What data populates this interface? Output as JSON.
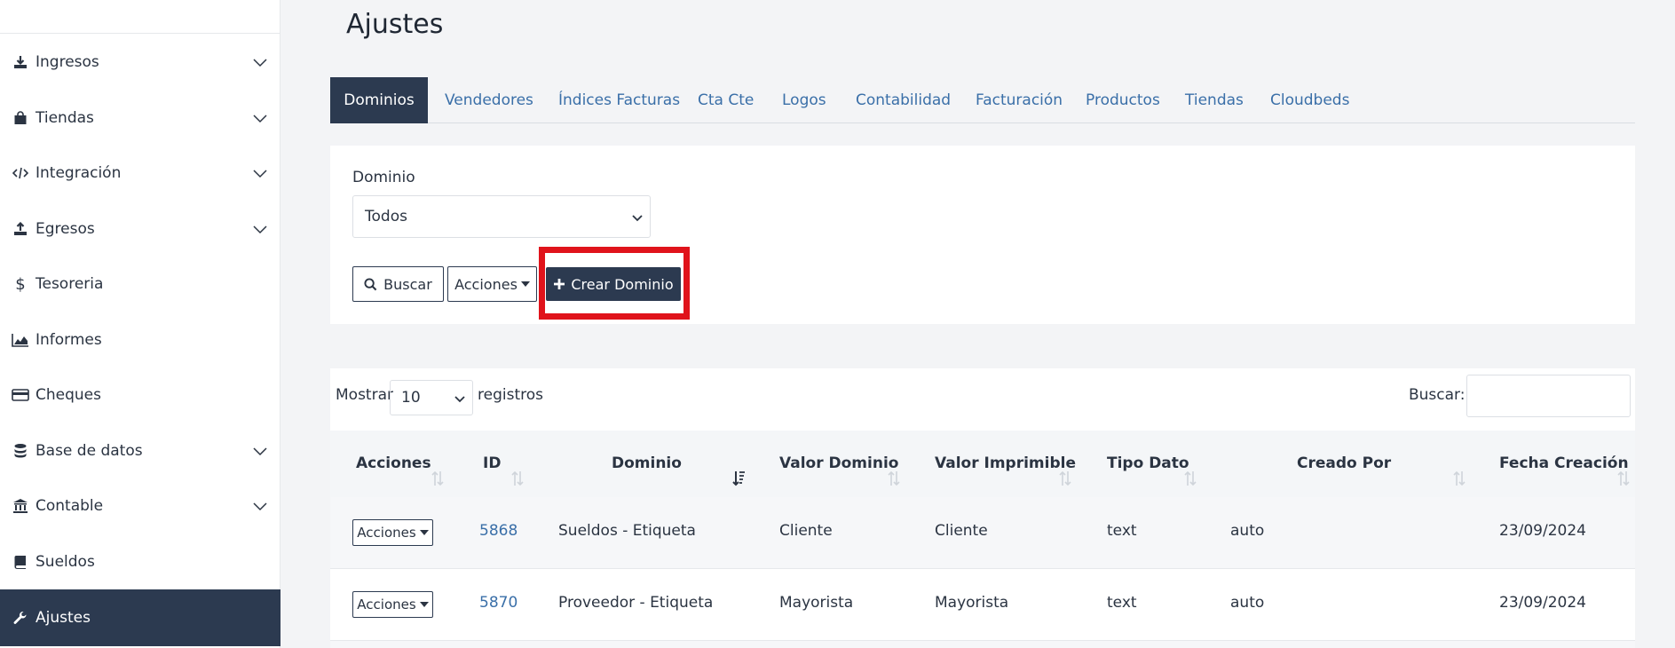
{
  "sidebar": {
    "items": [
      {
        "label": "Ingresos",
        "icon": "download-icon",
        "expandable": true
      },
      {
        "label": "Tiendas",
        "icon": "shopping-bag-icon",
        "expandable": true
      },
      {
        "label": "Integración",
        "icon": "code-icon",
        "expandable": true
      },
      {
        "label": "Egresos",
        "icon": "upload-icon",
        "expandable": true
      },
      {
        "label": "Tesoreria",
        "icon": "dollar-icon",
        "expandable": false
      },
      {
        "label": "Informes",
        "icon": "area-chart-icon",
        "expandable": false
      },
      {
        "label": "Cheques",
        "icon": "credit-card-icon",
        "expandable": false
      },
      {
        "label": "Base de datos",
        "icon": "database-icon",
        "expandable": true
      },
      {
        "label": "Contable",
        "icon": "bank-icon",
        "expandable": true
      },
      {
        "label": "Sueldos",
        "icon": "book-icon",
        "expandable": false
      },
      {
        "label": "Ajustes",
        "icon": "wrench-icon",
        "expandable": false,
        "active": true
      }
    ]
  },
  "page": {
    "title": "Ajustes"
  },
  "tabs": [
    {
      "label": "Dominios",
      "active": true
    },
    {
      "label": "Vendedores"
    },
    {
      "label": "Índices Facturas"
    },
    {
      "label": "Cta Cte"
    },
    {
      "label": "Logos"
    },
    {
      "label": "Contabilidad"
    },
    {
      "label": "Facturación"
    },
    {
      "label": "Productos"
    },
    {
      "label": "Tiendas"
    },
    {
      "label": "Cloudbeds"
    }
  ],
  "filter": {
    "label": "Dominio",
    "selected": "Todos",
    "buscar_label": "Buscar",
    "acciones_label": "Acciones",
    "crear_label": "Crear Dominio"
  },
  "table": {
    "length_label": "Mostrar",
    "length_value": "10",
    "length_after": "registros",
    "search_label": "Buscar:",
    "search_value": "",
    "headers": [
      "Acciones",
      "ID",
      "Dominio",
      "Valor Dominio",
      "Valor Imprimible",
      "Tipo Dato",
      "Creado Por",
      "Fecha Creación"
    ],
    "row_action_label": "Acciones",
    "rows": [
      {
        "id": "5868",
        "dominio": "Sueldos - Etiqueta",
        "valor_dominio": "Cliente",
        "valor_imprimible": "Cliente",
        "tipo_dato": "text",
        "creado_por": "auto",
        "fecha": "23/09/2024"
      },
      {
        "id": "5870",
        "dominio": "Proveedor - Etiqueta",
        "valor_dominio": "Mayorista",
        "valor_imprimible": "Mayorista",
        "tipo_dato": "text",
        "creado_por": "auto",
        "fecha": "23/09/2024"
      }
    ]
  },
  "colors": {
    "navy": "#2c3a50",
    "link": "#3a6fa8",
    "highlight": "#e0131b"
  }
}
